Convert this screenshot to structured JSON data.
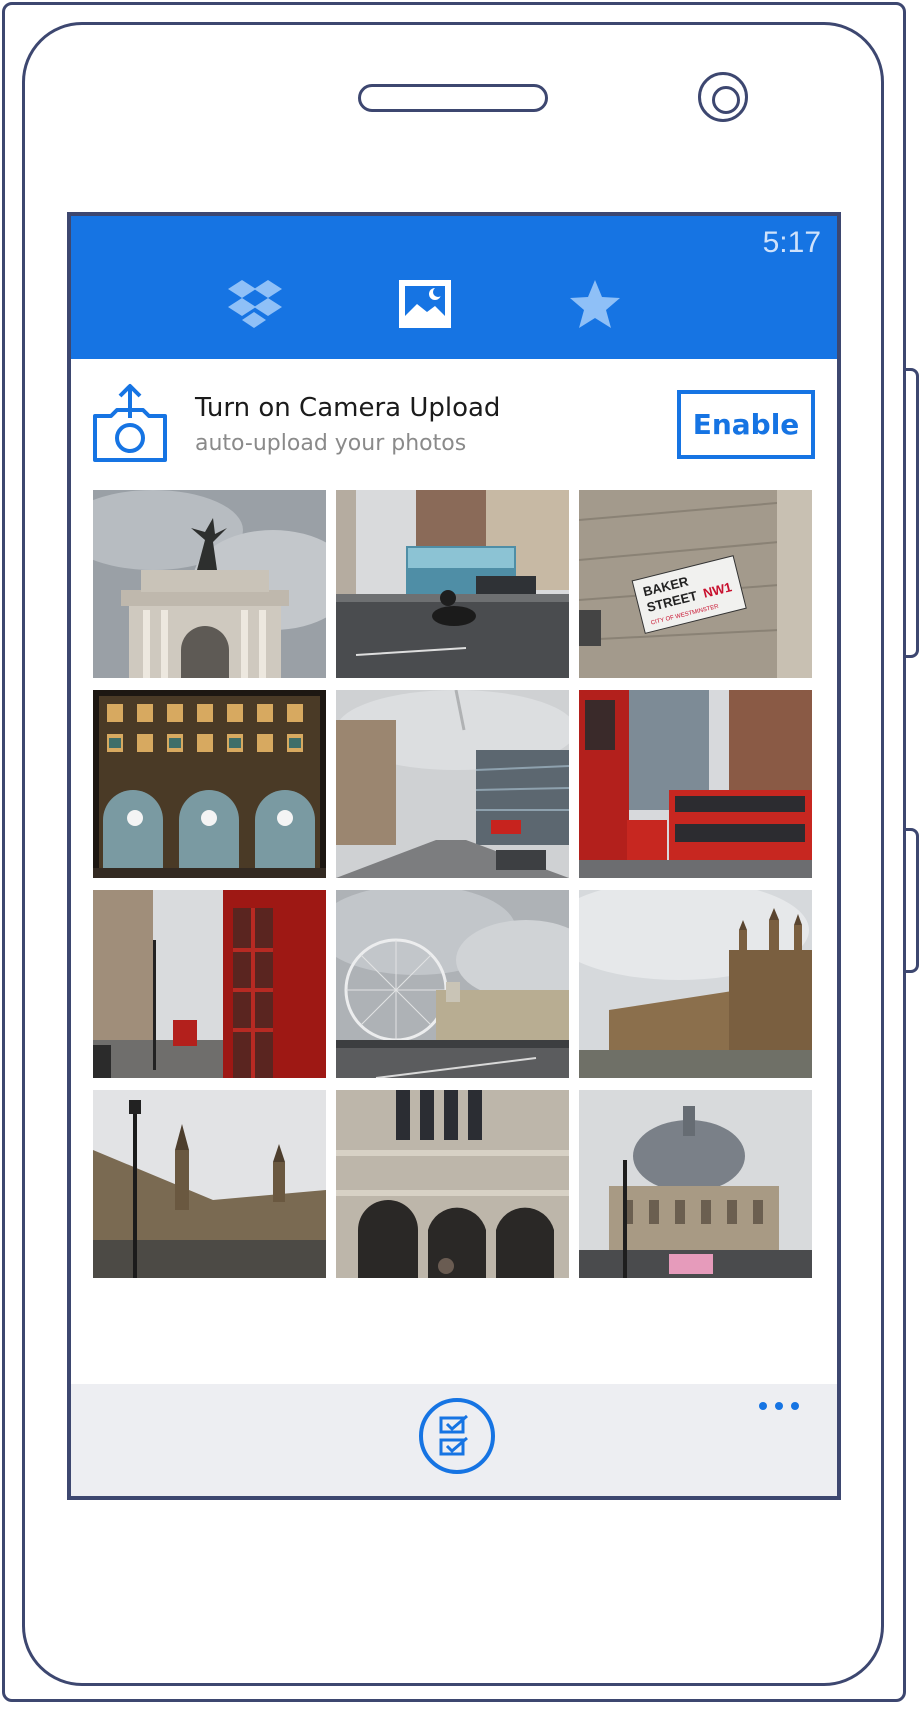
{
  "status_bar": {
    "time": "5:17"
  },
  "nav_tabs": [
    {
      "name": "files",
      "icon": "dropbox-icon"
    },
    {
      "name": "photos",
      "icon": "photos-icon",
      "selected": true
    },
    {
      "name": "favorites",
      "icon": "star-icon"
    }
  ],
  "camera_upload": {
    "title": "Turn on Camera Upload",
    "subtitle": "auto-upload your photos",
    "enable_label": "Enable"
  },
  "photos": [
    {
      "subject": "wellington-arch"
    },
    {
      "subject": "street-with-bus-and-scooter"
    },
    {
      "subject": "baker-street-sign",
      "sign_line1": "BAKER",
      "sign_line2": "STREET",
      "sign_code": "NW1",
      "sign_sub": "CITY OF WESTMINSTER"
    },
    {
      "subject": "apple-store-night"
    },
    {
      "subject": "whitehall-street"
    },
    {
      "subject": "red-double-decker-buses"
    },
    {
      "subject": "red-phone-box"
    },
    {
      "subject": "london-eye"
    },
    {
      "subject": "houses-of-parliament"
    },
    {
      "subject": "parliament-with-lamppost"
    },
    {
      "subject": "westminster-abbey-gate"
    },
    {
      "subject": "domed-building-pink-taxi"
    }
  ],
  "app_bar": {
    "select_icon": "select-checklist-icon",
    "more_icon": "more-dots-icon"
  },
  "colors": {
    "accent": "#1674e3",
    "frame": "#3d4770",
    "appbar": "#ecedf1"
  }
}
